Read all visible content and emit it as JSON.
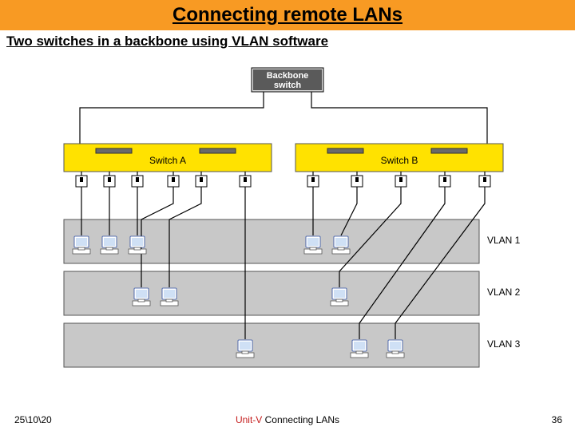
{
  "title": "Connecting remote LANs",
  "subtitle": "Two switches in a backbone using VLAN software",
  "diagram": {
    "backbone_label_line1": "Backbone",
    "backbone_label_line2": "switch",
    "switch_a_label": "Switch A",
    "switch_b_label": "Switch B",
    "vlan1_label": "VLAN 1",
    "vlan2_label": "VLAN 2",
    "vlan3_label": "VLAN 3"
  },
  "footer": {
    "date": "25\\10\\20",
    "unit_prefix": "Unit-V",
    "unit_suffix": " Connecting LANs",
    "page": "36"
  }
}
